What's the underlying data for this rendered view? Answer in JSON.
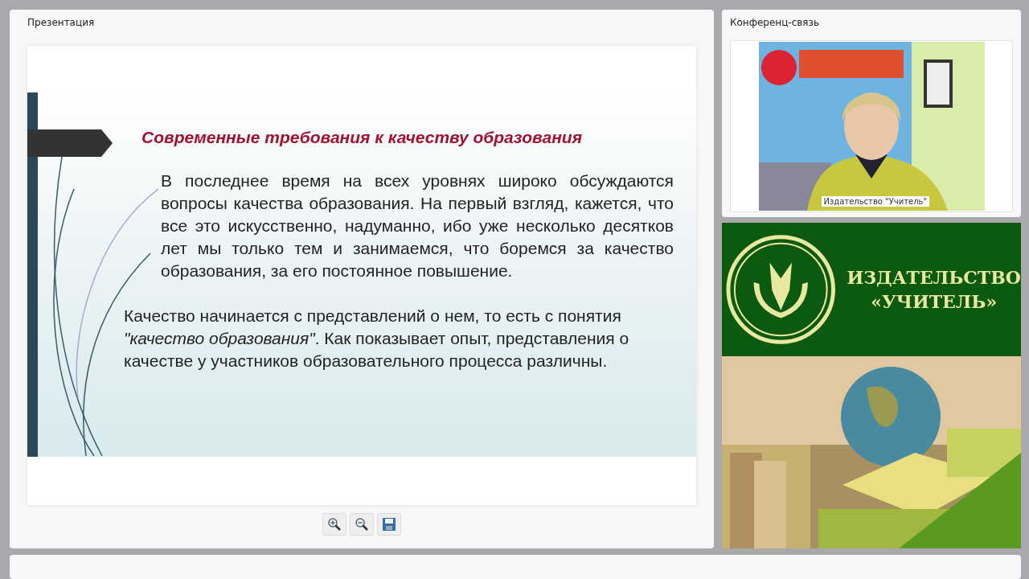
{
  "presentation_panel": {
    "title": "Презентация",
    "slide": {
      "heading": "Современные требования к качеству образования",
      "paragraphs": [
        "В последнее время на всех уровнях широко обсуждаются вопросы качества образования. На первый взгляд, кажется, что все это искусственно, надуманно, ибо уже несколько десятков лет мы только тем и занимаемся, что боремся за качество образования, за его постоянное повышение.",
        "Качество начинается с представлений о нем, то есть с понятия *\"качество образования\"*. Как показывает опыт, представления о качестве у участников образовательного процесса различны."
      ]
    },
    "toolbar": [
      {
        "kind": "zoom-in"
      },
      {
        "kind": "zoom-out"
      },
      {
        "kind": "save"
      }
    ]
  },
  "conference_panel": {
    "title": "Конференц-связь",
    "video": {
      "kind": "picture",
      "caption": "Издательство \"Учитель\""
    }
  },
  "banner": {
    "lines": [
      "ИЗДАТЕЛЬСТВО",
      "«УЧИТЕЛЬ»"
    ]
  }
}
